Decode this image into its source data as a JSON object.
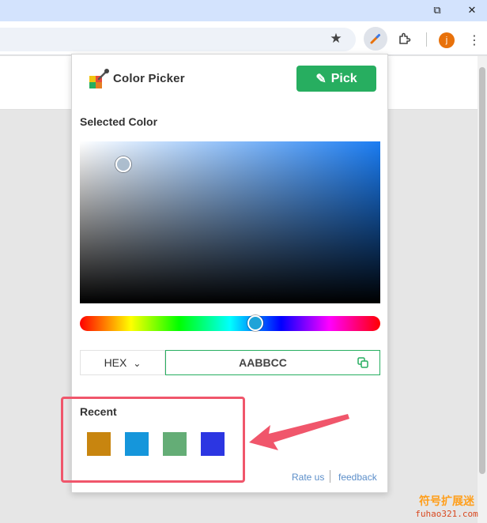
{
  "browser": {
    "window_controls": {
      "restore": "⧉",
      "close": "✕"
    },
    "toolbar": {
      "bookmark_icon": "★",
      "extension_active_icon": "eyedropper-icon",
      "extensions_icon": "puzzle-icon",
      "profile_initial": "j",
      "menu_icon": "⋮"
    }
  },
  "popup": {
    "app_title": "Color Picker",
    "pick_button": {
      "icon": "✎",
      "label": "Pick"
    },
    "selected_color_title": "Selected Color",
    "format_select": {
      "value": "HEX",
      "chevron": "⌄"
    },
    "hex_value": "AABBCC",
    "recent_title": "Recent",
    "recent_colors": [
      "#c8850f",
      "#1596db",
      "#64ad76",
      "#2c36e2"
    ],
    "footer": {
      "rate_us": "Rate us",
      "feedback": "feedback"
    }
  },
  "colors": {
    "accent_green": "#27ae60",
    "highlight_red": "#f0566b",
    "link_blue": "#5b8ec9",
    "selected_hue": "#1a7cf2"
  },
  "watermark": {
    "top": "符号扩展迷",
    "bottom": "fuhao321.com"
  }
}
